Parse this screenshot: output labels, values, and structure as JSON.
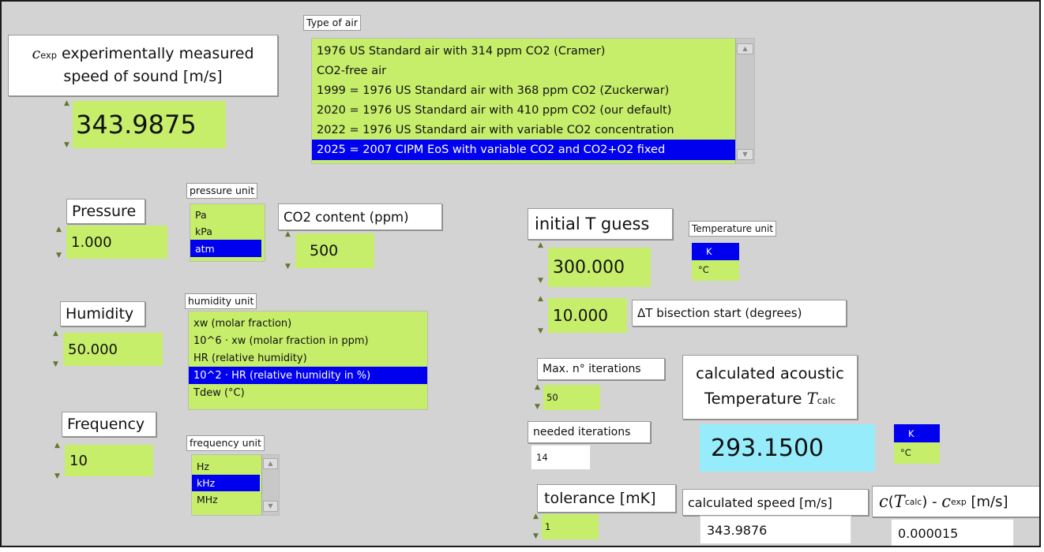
{
  "speed_label": {
    "c": "c",
    "sub": "exp",
    "line1_rest": " experimentally measured",
    "line2": "speed of sound [m/s]"
  },
  "speed_value": "343.9875",
  "air_type": {
    "caption": "Type of air",
    "items": [
      "1976 US Standard air with 314 ppm CO2 (Cramer)",
      "CO2-free air",
      "1999 = 1976 US Standard air with 368 ppm CO2 (Zuckerwar)",
      "2020 = 1976 US Standard air with 410 ppm CO2 (our default)",
      "2022 = 1976 US Standard air with variable CO2 concentration",
      "2025 = 2007 CIPM EoS with variable CO2 and CO2+O2 fixed"
    ],
    "selected": "2025 = 2007 CIPM EoS with variable CO2 and CO2+O2 fixed"
  },
  "pressure": {
    "label": "Pressure",
    "value": "1.000",
    "unit_caption": "pressure unit",
    "units": [
      "Pa",
      "kPa",
      "atm"
    ],
    "selected_unit": "atm"
  },
  "co2": {
    "label": "CO2 content (ppm)",
    "value": "500"
  },
  "humidity": {
    "label": "Humidity",
    "value": "50.000",
    "unit_caption": "humidity unit",
    "units": [
      "xw (molar fraction)",
      "10^6 · xw (molar fraction in ppm)",
      "HR (relative humidity)",
      "10^2 · HR (relative humidity in %)",
      "Tdew (°C)"
    ],
    "selected_unit": "10^2 · HR (relative humidity in %)"
  },
  "frequency": {
    "label": "Frequency",
    "value": "10",
    "unit_caption": "frequency unit",
    "units": [
      "Hz",
      "kHz",
      "MHz"
    ],
    "selected_unit": "kHz"
  },
  "initial_t": {
    "label": "initial T guess",
    "value": "300.000"
  },
  "temperature_unit": {
    "caption": "Temperature unit",
    "units": [
      "K",
      "°C"
    ],
    "selected_unit": "K"
  },
  "dt_bisection": {
    "value": "10.000",
    "label": "ΔT bisection start (degrees)"
  },
  "max_iterations": {
    "label": "Max. n° iterations",
    "value": "50"
  },
  "needed_iterations": {
    "label": "needed iterations",
    "value": "14"
  },
  "tolerance": {
    "label": "tolerance [mK]",
    "value": "1"
  },
  "t_calc": {
    "line1": "calculated acoustic",
    "line2": "Temperature ",
    "t": "T",
    "sub": "calc",
    "value": "293.1500"
  },
  "t_calc_unit": {
    "units": [
      "K",
      "°C"
    ],
    "selected_unit": "K"
  },
  "calc_speed": {
    "label": "calculated speed [m/s]",
    "value": "343.9876"
  },
  "diff": {
    "c": "c",
    "t": "T",
    "t_sub": "calc",
    "minus": " - ",
    "c2": "c",
    "c2_sub": "exp",
    "unit": " [m/s]",
    "value": "0.000015"
  },
  "colors": {
    "field_green": "#c6ee6b",
    "indicator_cyan": "#96ecfa",
    "selection_blue": "#0000ee",
    "panel_gray": "#d3d3d3"
  }
}
